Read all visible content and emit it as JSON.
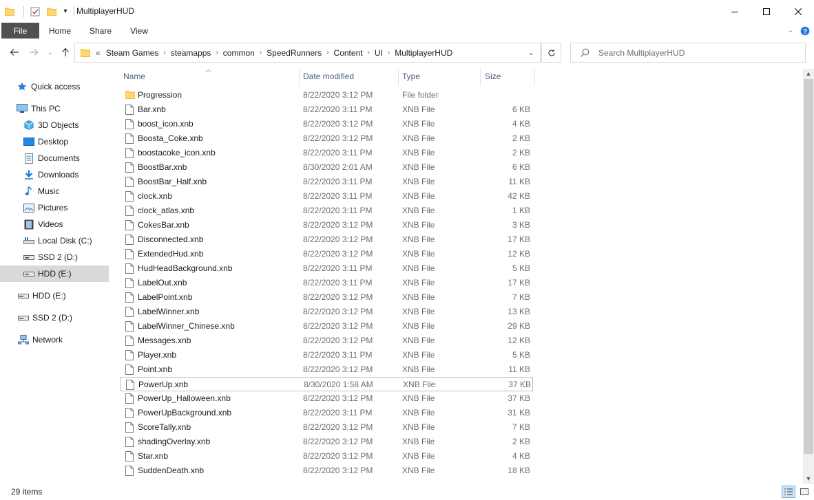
{
  "window": {
    "title": "MultiplayerHUD",
    "minimize_icon": "minimize-icon",
    "maximize_icon": "maximize-icon",
    "close_icon": "close-icon"
  },
  "ribbon": {
    "tabs": [
      {
        "label": "File"
      },
      {
        "label": "Home"
      },
      {
        "label": "Share"
      },
      {
        "label": "View"
      }
    ]
  },
  "address": {
    "overflow": "«",
    "crumbs": [
      "Steam Games",
      "steamapps",
      "common",
      "SpeedRunners",
      "Content",
      "UI",
      "MultiplayerHUD"
    ]
  },
  "search": {
    "placeholder": "Search MultiplayerHUD"
  },
  "navpane": {
    "items": [
      {
        "label": "Quick access",
        "icon": "star-icon"
      },
      {
        "label": "This PC",
        "icon": "computer-icon"
      },
      {
        "label": "3D Objects",
        "icon": "cube-icon"
      },
      {
        "label": "Desktop",
        "icon": "desktop-icon"
      },
      {
        "label": "Documents",
        "icon": "documents-icon"
      },
      {
        "label": "Downloads",
        "icon": "download-icon"
      },
      {
        "label": "Music",
        "icon": "music-icon"
      },
      {
        "label": "Pictures",
        "icon": "pictures-icon"
      },
      {
        "label": "Videos",
        "icon": "videos-icon"
      },
      {
        "label": "Local Disk (C:)",
        "icon": "windows-drive-icon"
      },
      {
        "label": "SSD 2 (D:)",
        "icon": "drive-icon"
      },
      {
        "label": "HDD (E:)",
        "icon": "drive-icon"
      },
      {
        "label": "HDD (E:)",
        "icon": "drive-icon"
      },
      {
        "label": "SSD 2 (D:)",
        "icon": "drive-icon"
      },
      {
        "label": "Network",
        "icon": "network-icon"
      }
    ]
  },
  "columns": {
    "name": "Name",
    "date": "Date modified",
    "type": "Type",
    "size": "Size"
  },
  "files": [
    {
      "name": "Progression",
      "date": "8/22/2020 3:12 PM",
      "type": "File folder",
      "size": ""
    },
    {
      "name": "Bar.xnb",
      "date": "8/22/2020 3:11 PM",
      "type": "XNB File",
      "size": "6 KB"
    },
    {
      "name": "boost_icon.xnb",
      "date": "8/22/2020 3:12 PM",
      "type": "XNB File",
      "size": "4 KB"
    },
    {
      "name": "Boosta_Coke.xnb",
      "date": "8/22/2020 3:12 PM",
      "type": "XNB File",
      "size": "2 KB"
    },
    {
      "name": "boostacoke_icon.xnb",
      "date": "8/22/2020 3:11 PM",
      "type": "XNB File",
      "size": "2 KB"
    },
    {
      "name": "BoostBar.xnb",
      "date": "8/30/2020 2:01 AM",
      "type": "XNB File",
      "size": "6 KB"
    },
    {
      "name": "BoostBar_Half.xnb",
      "date": "8/22/2020 3:11 PM",
      "type": "XNB File",
      "size": "11 KB"
    },
    {
      "name": "clock.xnb",
      "date": "8/22/2020 3:11 PM",
      "type": "XNB File",
      "size": "42 KB"
    },
    {
      "name": "clock_atlas.xnb",
      "date": "8/22/2020 3:11 PM",
      "type": "XNB File",
      "size": "1 KB"
    },
    {
      "name": "CokesBar.xnb",
      "date": "8/22/2020 3:12 PM",
      "type": "XNB File",
      "size": "3 KB"
    },
    {
      "name": "Disconnected.xnb",
      "date": "8/22/2020 3:12 PM",
      "type": "XNB File",
      "size": "17 KB"
    },
    {
      "name": "ExtendedHud.xnb",
      "date": "8/22/2020 3:12 PM",
      "type": "XNB File",
      "size": "12 KB"
    },
    {
      "name": "HudHeadBackground.xnb",
      "date": "8/22/2020 3:11 PM",
      "type": "XNB File",
      "size": "5 KB"
    },
    {
      "name": "LabelOut.xnb",
      "date": "8/22/2020 3:11 PM",
      "type": "XNB File",
      "size": "17 KB"
    },
    {
      "name": "LabelPoint.xnb",
      "date": "8/22/2020 3:12 PM",
      "type": "XNB File",
      "size": "7 KB"
    },
    {
      "name": "LabelWinner.xnb",
      "date": "8/22/2020 3:12 PM",
      "type": "XNB File",
      "size": "13 KB"
    },
    {
      "name": "LabelWinner_Chinese.xnb",
      "date": "8/22/2020 3:12 PM",
      "type": "XNB File",
      "size": "29 KB"
    },
    {
      "name": "Messages.xnb",
      "date": "8/22/2020 3:12 PM",
      "type": "XNB File",
      "size": "12 KB"
    },
    {
      "name": "Player.xnb",
      "date": "8/22/2020 3:11 PM",
      "type": "XNB File",
      "size": "5 KB"
    },
    {
      "name": "Point.xnb",
      "date": "8/22/2020 3:12 PM",
      "type": "XNB File",
      "size": "11 KB"
    },
    {
      "name": "PowerUp.xnb",
      "date": "8/30/2020 1:58 AM",
      "type": "XNB File",
      "size": "37 KB"
    },
    {
      "name": "PowerUp_Halloween.xnb",
      "date": "8/22/2020 3:12 PM",
      "type": "XNB File",
      "size": "37 KB"
    },
    {
      "name": "PowerUpBackground.xnb",
      "date": "8/22/2020 3:11 PM",
      "type": "XNB File",
      "size": "31 KB"
    },
    {
      "name": "ScoreTally.xnb",
      "date": "8/22/2020 3:12 PM",
      "type": "XNB File",
      "size": "7 KB"
    },
    {
      "name": "shadingOverlay.xnb",
      "date": "8/22/2020 3:12 PM",
      "type": "XNB File",
      "size": "2 KB"
    },
    {
      "name": "Star.xnb",
      "date": "8/22/2020 3:12 PM",
      "type": "XNB File",
      "size": "4 KB"
    },
    {
      "name": "SuddenDeath.xnb",
      "date": "8/22/2020 3:12 PM",
      "type": "XNB File",
      "size": "18 KB"
    }
  ],
  "focused_row": 20,
  "status": {
    "count": "29 items"
  },
  "colors": {
    "folder": "#ffd76e",
    "file_tab_bg": "#505050",
    "selected_nav": "#d9d9d9",
    "column_header": "#4c607a",
    "meta_text": "#6d6d6d"
  }
}
